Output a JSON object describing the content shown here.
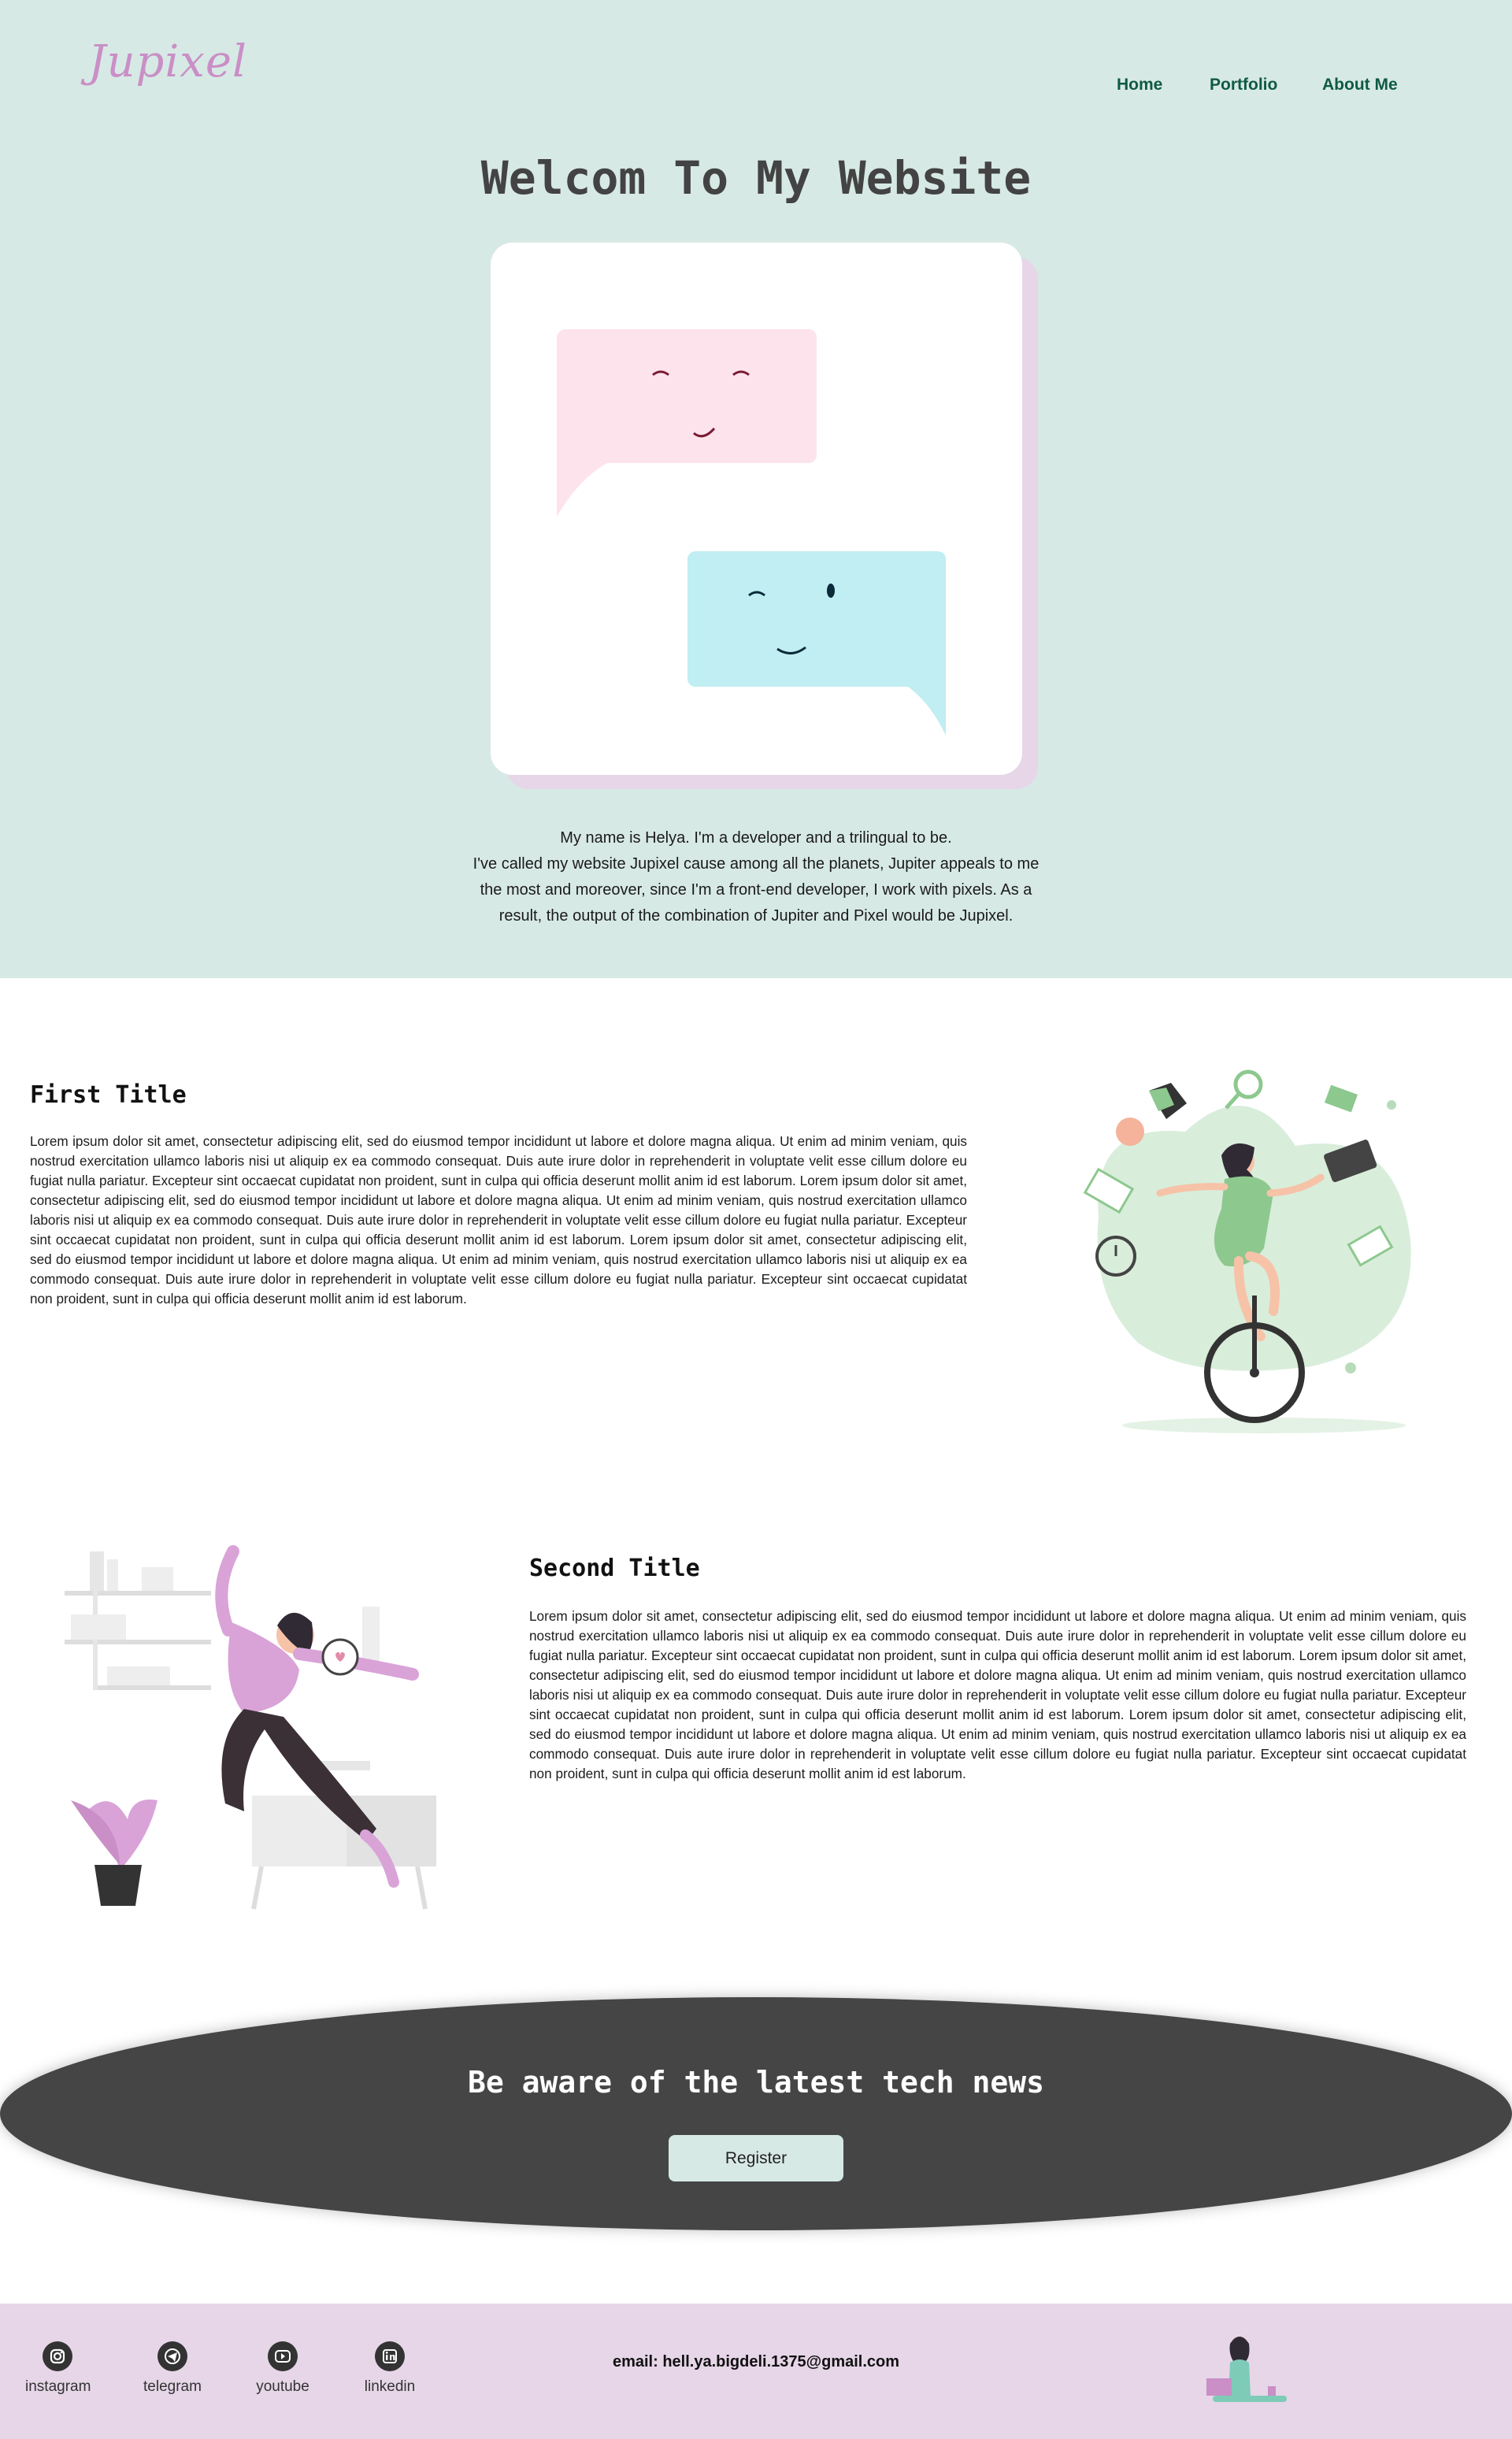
{
  "header": {
    "logo": "Jupixel",
    "nav": [
      "Home",
      "Portfolio",
      "About Me"
    ]
  },
  "hero": {
    "title": "Welcom To My Website",
    "bio": [
      "My name is Helya. I'm a developer and a trilingual to be.",
      "I've called my website Jupixel cause among all the planets, Jupiter appeals to me",
      "the most and moreover, since I'm a front-end developer, I work with pixels. As a",
      "result, the output of the combination of Jupiter and Pixel would be Jupixel."
    ]
  },
  "sections": [
    {
      "title": "First Title",
      "text": "Lorem ipsum dolor sit amet, consectetur adipiscing elit, sed do eiusmod tempor incididunt ut labore et dolore magna aliqua. Ut enim ad minim veniam, quis nostrud exercitation ullamco laboris nisi ut aliquip ex ea commodo consequat. Duis aute irure dolor in reprehenderit in voluptate velit esse cillum dolore eu fugiat nulla pariatur. Excepteur sint occaecat cupidatat non proident, sunt in culpa qui officia deserunt mollit anim id est laborum. Lorem ipsum dolor sit amet, consectetur adipiscing elit, sed do eiusmod tempor incididunt ut labore et dolore magna aliqua. Ut enim ad minim veniam, quis nostrud exercitation ullamco laboris nisi ut aliquip ex ea commodo consequat. Duis aute irure dolor in reprehenderit in voluptate velit esse cillum dolore eu fugiat nulla pariatur. Excepteur sint occaecat cupidatat non proident, sunt in culpa qui officia deserunt mollit anim id est laborum. Lorem ipsum dolor sit amet, consectetur adipiscing elit, sed do eiusmod tempor incididunt ut labore et dolore magna aliqua. Ut enim ad minim veniam, quis nostrud exercitation ullamco laboris nisi ut aliquip ex ea commodo consequat. Duis aute irure dolor in reprehenderit in voluptate velit esse cillum dolore eu fugiat nulla pariatur. Excepteur sint occaecat cupidatat non proident, sunt in culpa qui officia deserunt mollit anim id est laborum."
    },
    {
      "title": "Second Title",
      "text": "Lorem ipsum dolor sit amet, consectetur adipiscing elit, sed do eiusmod tempor incididunt ut labore et dolore magna aliqua. Ut enim ad minim veniam, quis nostrud exercitation ullamco laboris nisi ut aliquip ex ea commodo consequat. Duis aute irure dolor in reprehenderit in voluptate velit esse cillum dolore eu fugiat nulla pariatur. Excepteur sint occaecat cupidatat non proident, sunt in culpa qui officia deserunt mollit anim id est laborum. Lorem ipsum dolor sit amet, consectetur adipiscing elit, sed do eiusmod tempor incididunt ut labore et dolore magna aliqua. Ut enim ad minim veniam, quis nostrud exercitation ullamco laboris nisi ut aliquip ex ea commodo consequat. Duis aute irure dolor in reprehenderit in voluptate velit esse cillum dolore eu fugiat nulla pariatur. Excepteur sint occaecat cupidatat non proident, sunt in culpa qui officia deserunt mollit anim id est laborum. Lorem ipsum dolor sit amet, consectetur adipiscing elit, sed do eiusmod tempor incididunt ut labore et dolore magna aliqua. Ut enim ad minim veniam, quis nostrud exercitation ullamco laboris nisi ut aliquip ex ea commodo consequat. Duis aute irure dolor in reprehenderit in voluptate velit esse cillum dolore eu fugiat nulla pariatur. Excepteur sint occaecat cupidatat non proident, sunt in culpa qui officia deserunt mollit anim id est laborum."
    }
  ],
  "news": {
    "title": "Be aware of the latest tech news",
    "button": "Register"
  },
  "footer": {
    "social": [
      {
        "label": "instagram",
        "icon": "instagram-icon"
      },
      {
        "label": "telegram",
        "icon": "telegram-icon"
      },
      {
        "label": "youtube",
        "icon": "youtube-icon"
      },
      {
        "label": "linkedin",
        "icon": "linkedin-icon"
      }
    ],
    "email": "email: hell.ya.bigdeli.1375@gmail.com"
  },
  "colors": {
    "hero_bg": "#d7e9e5",
    "nav_text": "#0f5a43",
    "news_bg": "#454545",
    "footer_bg": "#e6d6e8",
    "accent_pink": "#c98fc6",
    "accent_green": "#8dc88e"
  }
}
